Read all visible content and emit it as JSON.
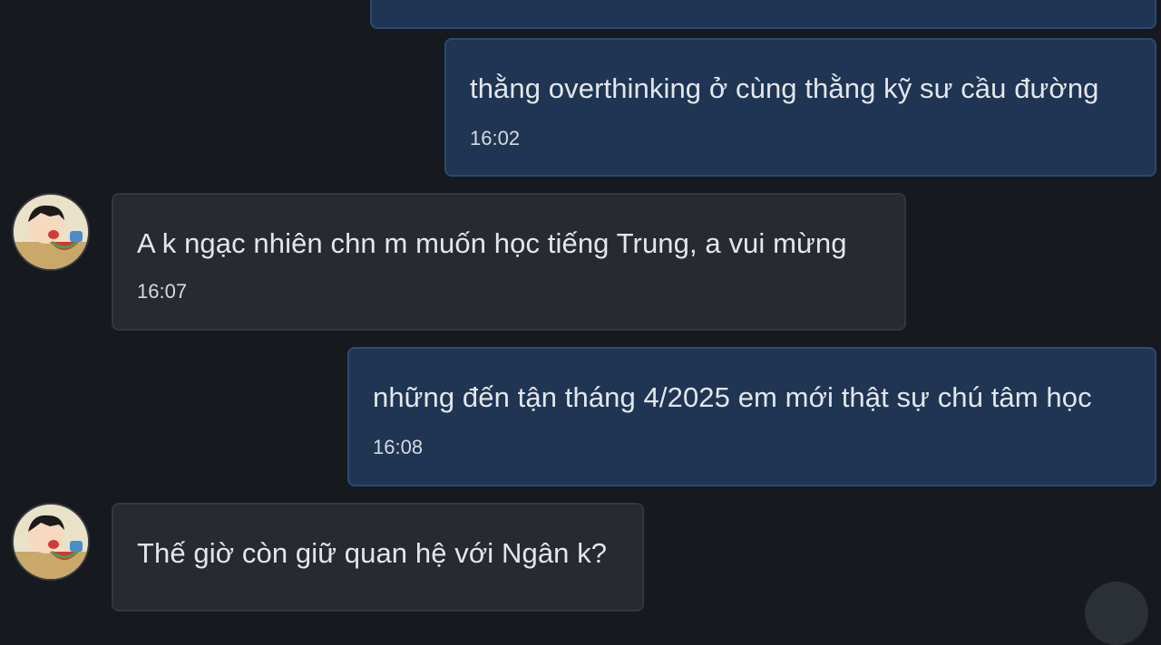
{
  "messages": [
    {
      "direction": "outgoing",
      "text": "",
      "time": ""
    },
    {
      "direction": "outgoing",
      "text": "thằng overthinking ở cùng thằng kỹ sư cầu đường",
      "time": "16:02"
    },
    {
      "direction": "incoming",
      "text": "A k ngạc nhiên chn m muốn học tiếng Trung, a vui mừng",
      "time": "16:07",
      "avatar": "cartoon-boy-avatar"
    },
    {
      "direction": "outgoing",
      "text": "những đến tận tháng 4/2025 em mới thật sự chú tâm học",
      "time": "16:08"
    },
    {
      "direction": "incoming",
      "text": "Thế giờ còn giữ quan hệ với Ngân k?",
      "time": "",
      "avatar": "cartoon-boy-avatar"
    }
  ],
  "colors": {
    "background": "#16191e",
    "outgoing_bubble": "#1f3553",
    "incoming_bubble": "#272a30"
  }
}
